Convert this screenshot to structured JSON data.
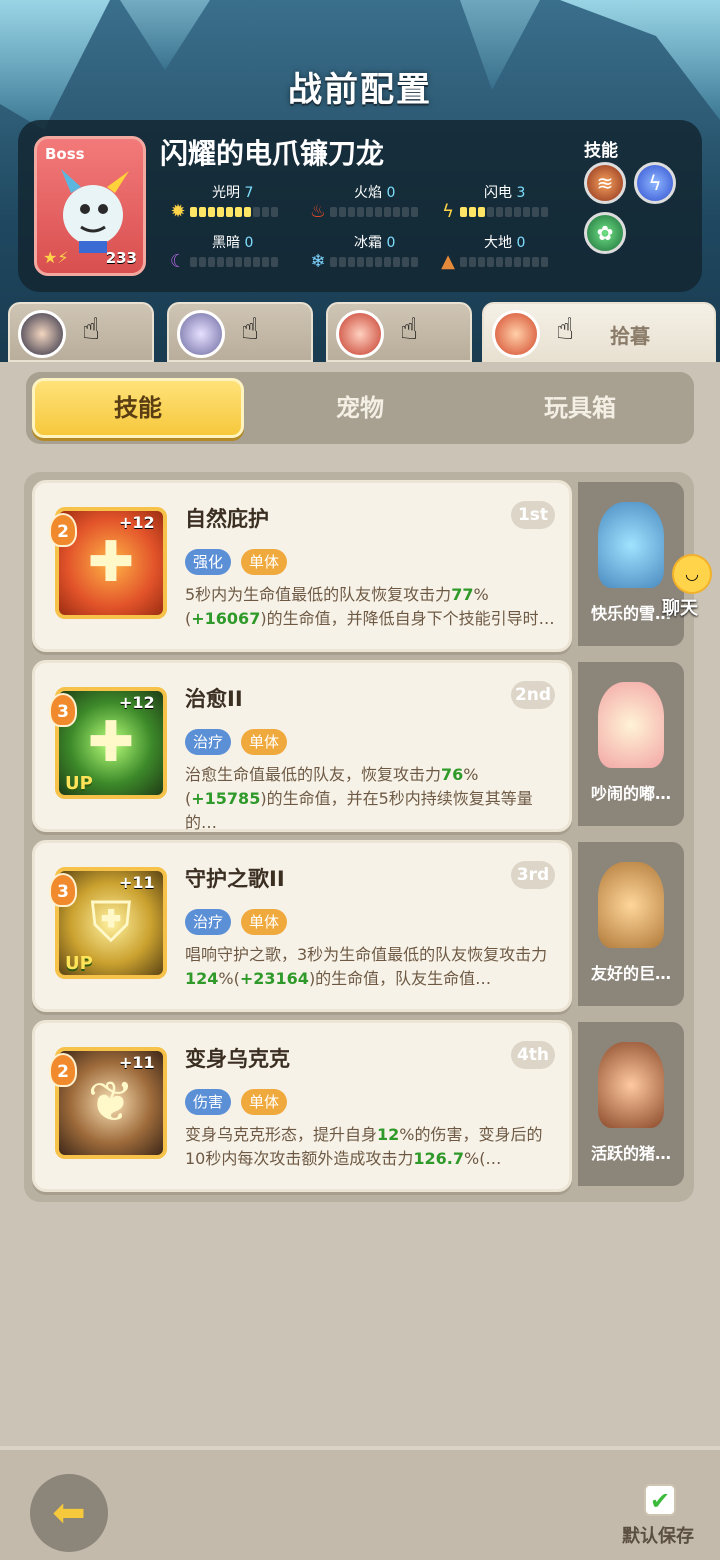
{
  "title": "战前配置",
  "boss": {
    "tag": "Boss",
    "name": "闪耀的电爪镰刀龙",
    "level": "233",
    "elements": [
      {
        "label": "光明",
        "value": "7",
        "icon": "sun-icon",
        "filled": 7
      },
      {
        "label": "火焰",
        "value": "0",
        "icon": "fire-icon",
        "filled": 0
      },
      {
        "label": "闪电",
        "value": "3",
        "icon": "lightning-icon",
        "filled": 3
      },
      {
        "label": "黑暗",
        "value": "0",
        "icon": "moon-icon",
        "filled": 0
      },
      {
        "label": "冰霜",
        "value": "0",
        "icon": "snowflake-icon",
        "filled": 0
      },
      {
        "label": "大地",
        "value": "0",
        "icon": "mountain-icon",
        "filled": 0
      }
    ],
    "skills_label": "技能"
  },
  "heroes": {
    "active_name": "拾暮"
  },
  "tabs": [
    "技能",
    "宠物",
    "玩具箱"
  ],
  "skills": [
    {
      "level": "2",
      "plus": "+12",
      "title": "自然庇护",
      "rank": "1st",
      "tags": [
        "强化",
        "单体"
      ],
      "desc_parts": [
        "5秒内为生命值最低的队友恢复攻击力",
        "77",
        "%(",
        "+16067",
        ")的生命值，并降低自身下个技能引导时…"
      ],
      "pet_name": "快乐的雪…"
    },
    {
      "level": "3",
      "plus": "+12",
      "title": "治愈II",
      "rank": "2nd",
      "up": "UP",
      "tags": [
        "治疗",
        "单体"
      ],
      "desc_parts": [
        "治愈生命值最低的队友，恢复攻击力",
        "76",
        "%(",
        "+15785",
        ")的生命值，并在5秒内持续恢复其等量的…"
      ],
      "pet_name": "吵闹的嘟…"
    },
    {
      "level": "3",
      "plus": "+11",
      "title": "守护之歌II",
      "rank": "3rd",
      "up": "UP",
      "tags": [
        "治疗",
        "单体"
      ],
      "desc_parts": [
        "唱响守护之歌，3秒为生命值最低的队友恢复攻击力",
        "124",
        "%(",
        "+23164",
        ")的生命值，队友生命值…"
      ],
      "pet_name": "友好的巨…"
    },
    {
      "level": "2",
      "plus": "+11",
      "title": "变身乌克克",
      "rank": "4th",
      "tags": [
        "伤害",
        "单体"
      ],
      "desc_parts": [
        "变身乌克克形态，提升自身",
        "12",
        "%的伤害，变身后的10秒内每次攻击额外造成攻击力",
        "126.7",
        "%(…"
      ],
      "pet_name": "活跃的猪…"
    }
  ],
  "chat_label": "聊天",
  "save_label": "默认保存"
}
